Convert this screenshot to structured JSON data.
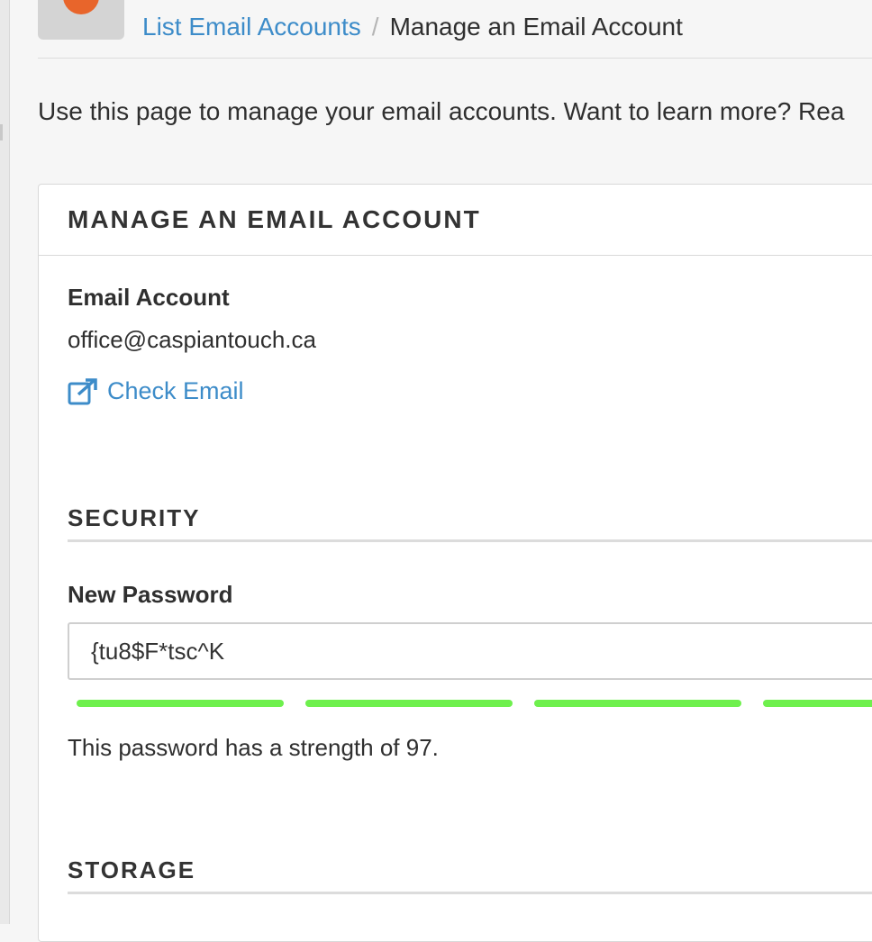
{
  "breadcrumb": {
    "parent": "List Email Accounts",
    "separator": "/",
    "current": "Manage an Email Account"
  },
  "intro_text": "Use this page to manage your email accounts. Want to learn more? Rea",
  "panel": {
    "title": "MANAGE AN EMAIL ACCOUNT",
    "email_account_label": "Email Account",
    "email_account_value": "office@caspiantouch.ca",
    "check_email_label": "Check Email",
    "check_email_icon": "external-link-icon",
    "security_heading": "SECURITY",
    "new_password_label": "New Password",
    "new_password_value": "{tu8$F*tsc^K",
    "strength_level": 0.97,
    "strength_color": "#6ef04d",
    "strength_text": "This password has a strength of 97.",
    "storage_heading": "STORAGE"
  },
  "colors": {
    "link": "#3d8cc9",
    "app_icon_accent": "#e8652b"
  },
  "app_icon": "email-app-icon"
}
